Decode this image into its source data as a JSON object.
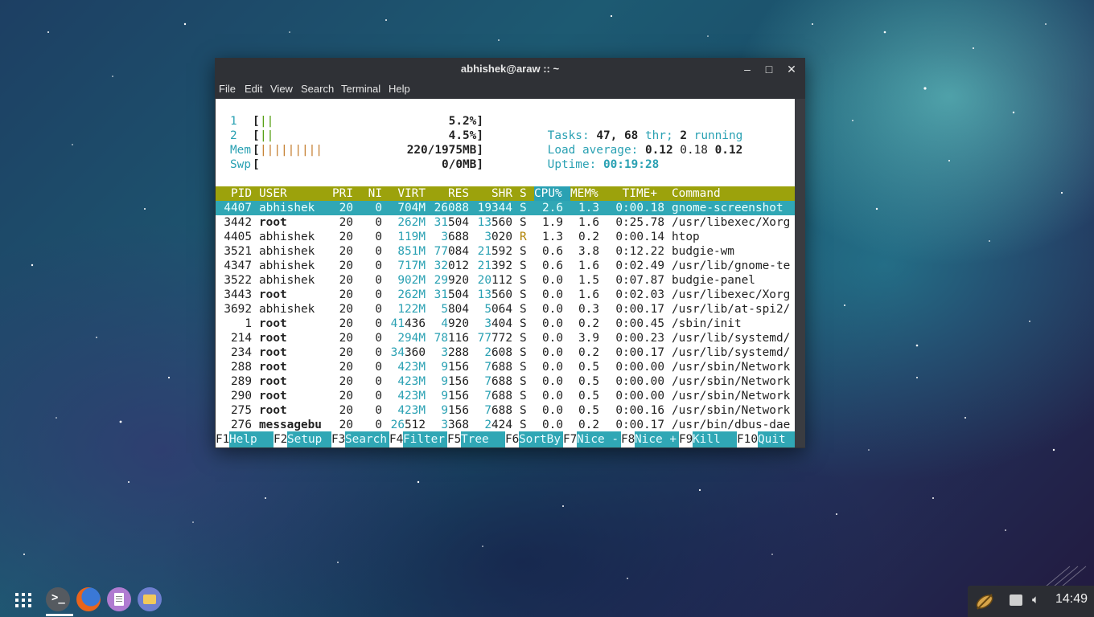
{
  "window": {
    "title": "abhishek@araw :: ~"
  },
  "menubar": [
    "File",
    "Edit",
    "View",
    "Search",
    "Terminal",
    "Help"
  ],
  "htop": {
    "meters": [
      {
        "label": "1",
        "bar": "||",
        "value": "5.2%]"
      },
      {
        "label": "2",
        "bar": "||",
        "value": "4.5%]"
      },
      {
        "label": "Mem",
        "bar": "|||||||||",
        "value": "220/1975MB]"
      },
      {
        "label": "Swp",
        "bar": "",
        "value": "0/0MB]"
      }
    ],
    "tasks_label": "Tasks:",
    "tasks_value": "47,",
    "thr_value": "68",
    "thr_label": "thr;",
    "running_value": "2",
    "running_label": "running",
    "load_label": "Load average:",
    "load_1": "0.12",
    "load_5": "0.18",
    "load_15": "0.12",
    "uptime_label": "Uptime:",
    "uptime_value": "00:19:28",
    "columns": [
      "PID",
      "USER",
      "PRI",
      "NI",
      "VIRT",
      "RES",
      "SHR",
      "S",
      "CPU%",
      "MEM%",
      "TIME+",
      "Command"
    ],
    "processes": [
      {
        "pid": "4407",
        "user": "abhishek",
        "pri": "20",
        "ni": "0",
        "virt": "704M",
        "res": "26088",
        "shr": "19344",
        "s": "S",
        "cpu": "2.6",
        "mem": "1.3",
        "time": "0:00.18",
        "cmd": "gnome-screenshot"
      },
      {
        "pid": "3442",
        "user": "root",
        "pri": "20",
        "ni": "0",
        "virt": "262M",
        "res": "31504",
        "shr": "13560",
        "s": "S",
        "cpu": "1.9",
        "mem": "1.6",
        "time": "0:25.78",
        "cmd": "/usr/libexec/Xorg"
      },
      {
        "pid": "4405",
        "user": "abhishek",
        "pri": "20",
        "ni": "0",
        "virt": "119M",
        "res": "3688",
        "shr": "3020",
        "s": "R",
        "cpu": "1.3",
        "mem": "0.2",
        "time": "0:00.14",
        "cmd": "htop"
      },
      {
        "pid": "3521",
        "user": "abhishek",
        "pri": "20",
        "ni": "0",
        "virt": "851M",
        "res": "77084",
        "shr": "21592",
        "s": "S",
        "cpu": "0.6",
        "mem": "3.8",
        "time": "0:12.22",
        "cmd": "budgie-wm"
      },
      {
        "pid": "4347",
        "user": "abhishek",
        "pri": "20",
        "ni": "0",
        "virt": "717M",
        "res": "32012",
        "shr": "21392",
        "s": "S",
        "cpu": "0.6",
        "mem": "1.6",
        "time": "0:02.49",
        "cmd": "/usr/lib/gnome-te"
      },
      {
        "pid": "3522",
        "user": "abhishek",
        "pri": "20",
        "ni": "0",
        "virt": "902M",
        "res": "29920",
        "shr": "20112",
        "s": "S",
        "cpu": "0.0",
        "mem": "1.5",
        "time": "0:07.87",
        "cmd": "budgie-panel"
      },
      {
        "pid": "3443",
        "user": "root",
        "pri": "20",
        "ni": "0",
        "virt": "262M",
        "res": "31504",
        "shr": "13560",
        "s": "S",
        "cpu": "0.0",
        "mem": "1.6",
        "time": "0:02.03",
        "cmd": "/usr/libexec/Xorg"
      },
      {
        "pid": "3692",
        "user": "abhishek",
        "pri": "20",
        "ni": "0",
        "virt": "122M",
        "res": "5804",
        "shr": "5064",
        "s": "S",
        "cpu": "0.0",
        "mem": "0.3",
        "time": "0:00.17",
        "cmd": "/usr/lib/at-spi2/"
      },
      {
        "pid": "1",
        "user": "root",
        "pri": "20",
        "ni": "0",
        "virt": "41436",
        "res": "4920",
        "shr": "3404",
        "s": "S",
        "cpu": "0.0",
        "mem": "0.2",
        "time": "0:00.45",
        "cmd": "/sbin/init"
      },
      {
        "pid": "214",
        "user": "root",
        "pri": "20",
        "ni": "0",
        "virt": "294M",
        "res": "78116",
        "shr": "77772",
        "s": "S",
        "cpu": "0.0",
        "mem": "3.9",
        "time": "0:00.23",
        "cmd": "/usr/lib/systemd/"
      },
      {
        "pid": "234",
        "user": "root",
        "pri": "20",
        "ni": "0",
        "virt": "34360",
        "res": "3288",
        "shr": "2608",
        "s": "S",
        "cpu": "0.0",
        "mem": "0.2",
        "time": "0:00.17",
        "cmd": "/usr/lib/systemd/"
      },
      {
        "pid": "288",
        "user": "root",
        "pri": "20",
        "ni": "0",
        "virt": "423M",
        "res": "9156",
        "shr": "7688",
        "s": "S",
        "cpu": "0.0",
        "mem": "0.5",
        "time": "0:00.00",
        "cmd": "/usr/sbin/Network"
      },
      {
        "pid": "289",
        "user": "root",
        "pri": "20",
        "ni": "0",
        "virt": "423M",
        "res": "9156",
        "shr": "7688",
        "s": "S",
        "cpu": "0.0",
        "mem": "0.5",
        "time": "0:00.00",
        "cmd": "/usr/sbin/Network"
      },
      {
        "pid": "290",
        "user": "root",
        "pri": "20",
        "ni": "0",
        "virt": "423M",
        "res": "9156",
        "shr": "7688",
        "s": "S",
        "cpu": "0.0",
        "mem": "0.5",
        "time": "0:00.00",
        "cmd": "/usr/sbin/Network"
      },
      {
        "pid": "275",
        "user": "root",
        "pri": "20",
        "ni": "0",
        "virt": "423M",
        "res": "9156",
        "shr": "7688",
        "s": "S",
        "cpu": "0.0",
        "mem": "0.5",
        "time": "0:00.16",
        "cmd": "/usr/sbin/Network"
      },
      {
        "pid": "276",
        "user": "messagebu",
        "pri": "20",
        "ni": "0",
        "virt": "26512",
        "res": "3368",
        "shr": "2424",
        "s": "S",
        "cpu": "0.0",
        "mem": "0.2",
        "time": "0:00.17",
        "cmd": "/usr/bin/dbus-dae"
      }
    ],
    "fkeys": [
      {
        "key": "F1",
        "label": "Help"
      },
      {
        "key": "F2",
        "label": "Setup"
      },
      {
        "key": "F3",
        "label": "Search"
      },
      {
        "key": "F4",
        "label": "Filter"
      },
      {
        "key": "F5",
        "label": "Tree"
      },
      {
        "key": "F6",
        "label": "SortBy"
      },
      {
        "key": "F7",
        "label": "Nice -"
      },
      {
        "key": "F8",
        "label": "Nice +"
      },
      {
        "key": "F9",
        "label": "Kill"
      },
      {
        "key": "F10",
        "label": "Quit"
      }
    ]
  },
  "taskbar": {
    "apps": [
      "terminal-icon",
      "firefox-icon",
      "text-editor-icon",
      "files-icon"
    ],
    "clock": "14:49"
  },
  "colors": {
    "header_bg": "#9ca20c",
    "highlight": "#30a7b5",
    "cyan_text": "#2aa1b3"
  }
}
